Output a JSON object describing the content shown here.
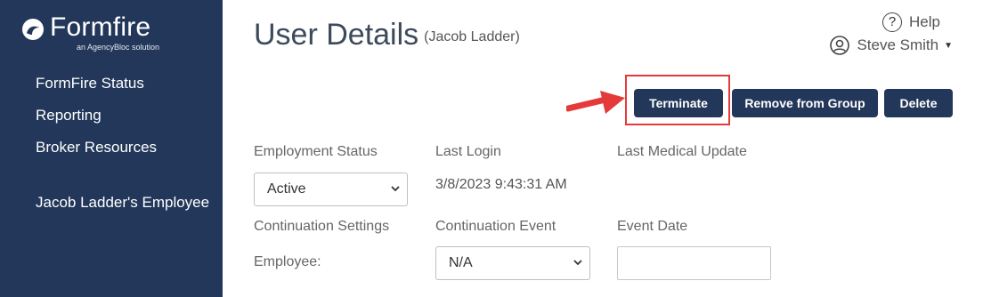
{
  "brand": {
    "name": "Formfire",
    "tagline": "an AgencyBloc solution",
    "color": "#22375a"
  },
  "sidebar": {
    "items": [
      {
        "label": "FormFire Status"
      },
      {
        "label": "Reporting"
      },
      {
        "label": "Broker Resources"
      },
      {
        "label": "Jacob Ladder's Employee"
      }
    ]
  },
  "header": {
    "title": "User Details",
    "subtitle": "(Jacob Ladder)",
    "help_label": "Help",
    "user_name": "Steve Smith",
    "icons": [
      "help-icon",
      "user-circle-icon",
      "caret-down-icon"
    ]
  },
  "actions": {
    "terminate_label": "Terminate",
    "remove_label": "Remove from Group",
    "delete_label": "Delete",
    "highlight_color": "#e53a3a"
  },
  "form": {
    "employment_status_label": "Employment Status",
    "employment_status_value": "Active",
    "last_login_label": "Last Login",
    "last_login_value": "3/8/2023 9:43:31 AM",
    "last_medical_label": "Last Medical Update",
    "continuation_settings_label": "Continuation Settings",
    "continuation_settings_value": "Employee:",
    "continuation_event_label": "Continuation Event",
    "continuation_event_value": "N/A",
    "event_date_label": "Event Date",
    "event_date_value": ""
  }
}
